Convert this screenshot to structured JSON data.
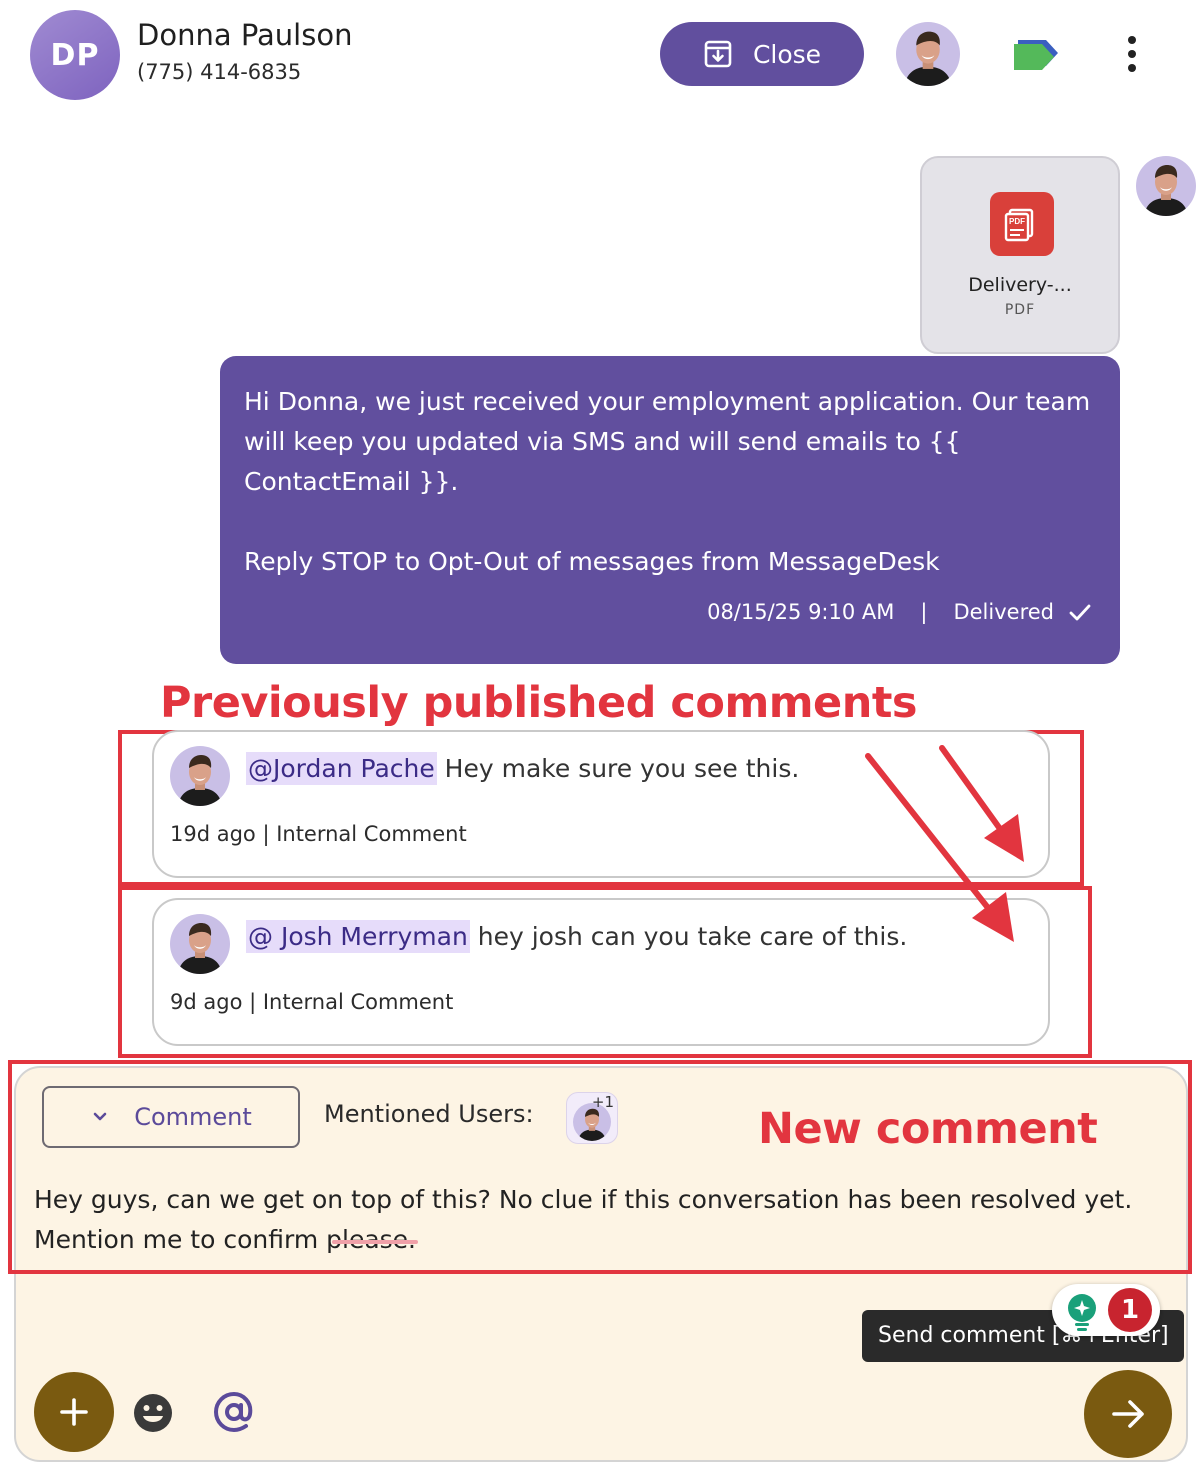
{
  "header": {
    "initials": "DP",
    "contact_name": "Donna Paulson",
    "contact_phone": "(775) 414-6835",
    "close_label": "Close"
  },
  "attachment": {
    "file_name": "Delivery-...",
    "file_type": "PDF",
    "icon_text": "PDF"
  },
  "message": {
    "body": "Hi Donna, we just received your employment application. Our team will keep you updated via SMS and will send emails to {{ ContactEmail }}.\n\nReply STOP to Opt-Out of messages from MessageDesk",
    "timestamp": "08/15/25 9:10 AM",
    "separator": "|",
    "status": "Delivered"
  },
  "annotations": {
    "previous_title": "Previously published comments",
    "new_title": "New comment"
  },
  "comments": [
    {
      "mention": "@Jordan Pache",
      "text": " Hey make sure you see this.",
      "meta": "19d ago | Internal Comment"
    },
    {
      "mention": "@ Josh Merryman",
      "text": " hey josh can you take care of this.",
      "meta": "9d ago | Internal Comment"
    }
  ],
  "composer": {
    "mode_label": "Comment",
    "mentioned_label": "Mentioned Users:",
    "mentioned_extra": "+1",
    "text": "Hey guys, can we get on top of this? No clue if this conversation has been resolved yet. Mention me to confirm please.",
    "tooltip": "Send comment [⌘+Enter]",
    "grammar_count": "1"
  },
  "colors": {
    "brand_purple": "#614f9e",
    "annotation_red": "#e2353f",
    "composer_bg": "#fdf4e4",
    "action_brown": "#7a5a10",
    "pdf_red": "#d9403a"
  },
  "icons": {
    "close": "archive-in-icon",
    "tag": "tag-icon",
    "menu": "kebab-menu-icon",
    "pdf": "pdf-icon",
    "delivered": "check-icon",
    "dropdown": "chevron-down-icon",
    "add": "plus-icon",
    "emoji": "emoji-icon",
    "mention": "at-sign-icon",
    "send": "arrow-right-icon",
    "grammar": "lightbulb-icon"
  }
}
